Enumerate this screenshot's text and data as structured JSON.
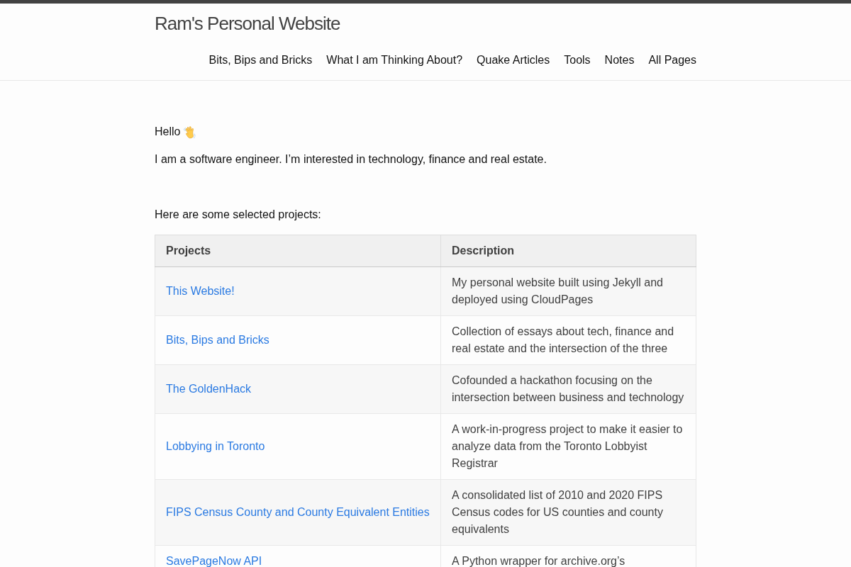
{
  "site_title": "Ram's Personal Website",
  "nav": [
    "Bits, Bips and Bricks",
    "What I am Thinking About?",
    "Quake Articles",
    "Tools",
    "Notes",
    "All Pages"
  ],
  "greeting": "Hello",
  "intro": "I am a software engineer. I’m interested in technology, finance and real estate.",
  "projects_intro": "Here are some selected projects:",
  "table": {
    "columns": [
      "Projects",
      "Description"
    ],
    "rows": [
      {
        "project": "This Website!",
        "description": "My personal website built using Jekyll and deployed using CloudPages"
      },
      {
        "project": "Bits, Bips and Bricks",
        "description": "Collection of essays about tech, finance and real estate and the intersection of the three"
      },
      {
        "project": "The GoldenHack",
        "description": "Cofounded a hackathon focusing on the intersection between business and technology"
      },
      {
        "project": "Lobbying in Toronto",
        "description": "A work-in-progress project to make it easier to analyze data from the Toronto Lobbyist Registrar"
      },
      {
        "project": "FIPS Census County and County Equivalent Entities",
        "description": "A consolidated list of 2010 and 2020 FIPS Census codes for US counties and county equivalents"
      },
      {
        "project": "SavePageNow API",
        "description": "A Python wrapper for archive.org’s"
      }
    ]
  }
}
